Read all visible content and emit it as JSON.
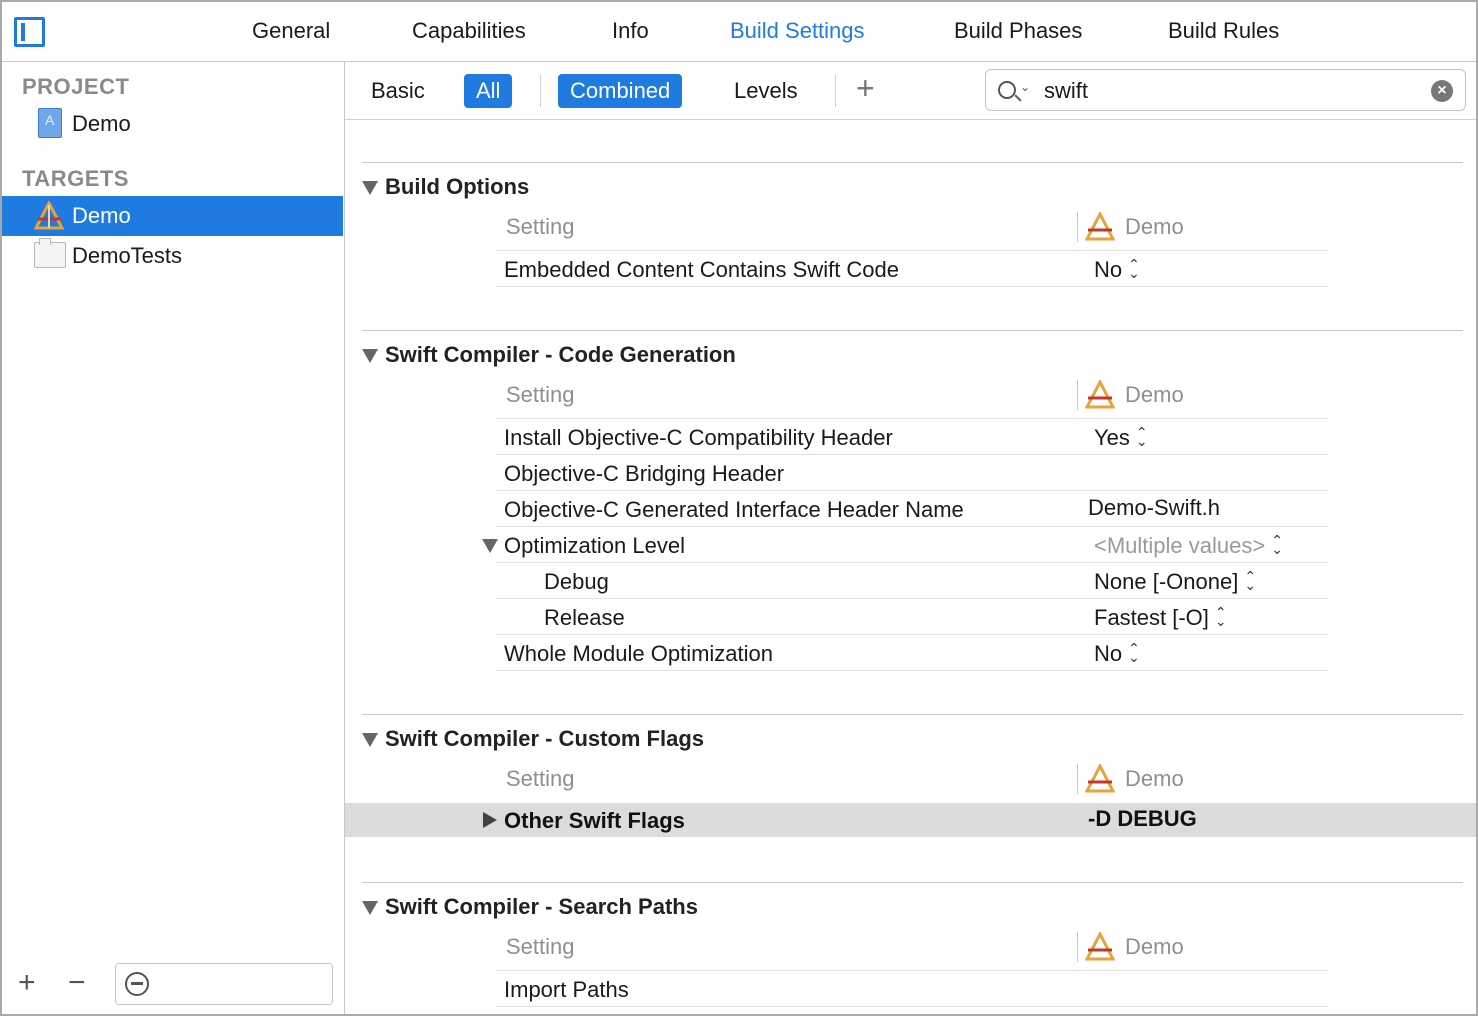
{
  "tabs": [
    "General",
    "Capabilities",
    "Info",
    "Build Settings",
    "Build Phases",
    "Build Rules"
  ],
  "active_tab": "Build Settings",
  "colors": {
    "accent": "#1f7be0",
    "selection": "#1f7be0",
    "highlight_row": "#dcdcdc"
  },
  "sidebar": {
    "project_header": "PROJECT",
    "project_item": "Demo",
    "targets_header": "TARGETS",
    "targets": [
      {
        "label": "Demo",
        "icon": "app-target-icon",
        "selected": true
      },
      {
        "label": "DemoTests",
        "icon": "test-bundle-icon",
        "selected": false
      }
    ],
    "add_symbol": "+",
    "remove_symbol": "−"
  },
  "filterbar": {
    "basic": "Basic",
    "all": "All",
    "combined": "Combined",
    "levels": "Levels",
    "add_symbol": "+",
    "search_value": "swift"
  },
  "column_setting": "Setting",
  "column_target": "Demo",
  "sections": [
    {
      "title": "Build Options",
      "rows": [
        {
          "name": "Embedded Content Contains Swift Code",
          "value": "No",
          "stepper": true
        }
      ]
    },
    {
      "title": "Swift Compiler - Code Generation",
      "rows": [
        {
          "name": "Install Objective-C Compatibility Header",
          "value": "Yes",
          "stepper": true
        },
        {
          "name": "Objective-C Bridging Header",
          "value": ""
        },
        {
          "name": "Objective-C Generated Interface Header Name",
          "value": "Demo-Swift.h"
        },
        {
          "name": "Optimization Level",
          "value": "<Multiple values>",
          "stepper": true
        },
        {
          "name": "Debug",
          "value": "None [-Onone]",
          "stepper": true
        },
        {
          "name": "Release",
          "value": "Fastest [-O]",
          "stepper": true
        },
        {
          "name": "Whole Module Optimization",
          "value": "No",
          "stepper": true
        }
      ]
    },
    {
      "title": "Swift Compiler - Custom Flags",
      "rows": [
        {
          "name": "Other Swift Flags",
          "value": "-D DEBUG"
        }
      ]
    },
    {
      "title": "Swift Compiler - Search Paths",
      "rows": [
        {
          "name": "Import Paths",
          "value": ""
        }
      ]
    }
  ],
  "stepper_glyph": {
    "up": "⌃",
    "down": "⌄"
  }
}
